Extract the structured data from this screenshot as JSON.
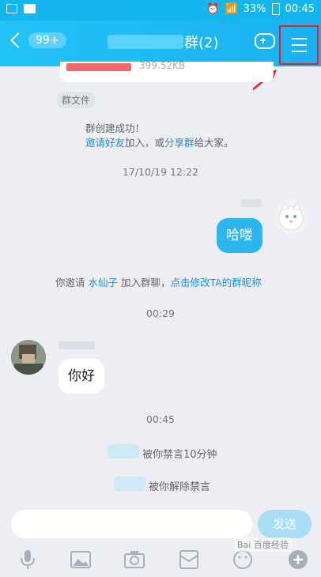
{
  "status_bar": {
    "battery": "33%",
    "time": "00:45"
  },
  "header": {
    "back_badge": "99+",
    "title_suffix": "群(2)"
  },
  "messages": {
    "file_size": "399.52KB",
    "file_tag": "群文件",
    "group_created": "群创建成功！",
    "invite_friends_link": "邀请好友",
    "invite_middle": "加入，或",
    "share_group_link": "分享群",
    "invite_end": "给大家。",
    "time1": "17/10/19 12:22",
    "my_message": "哈喽",
    "invite_notice_prefix": "你邀请",
    "invitee_name": "水仙子",
    "invite_notice_mid": "加入群聊，",
    "modify_nickname_link": "点击修改TA的群昵称",
    "time2": "00:29",
    "their_message": "你好",
    "time3": "00:45",
    "muted_text": "被你禁言10分钟",
    "unmuted_text": "被你解除禁言"
  },
  "input": {
    "placeholder": "",
    "send_label": "发送"
  },
  "watermark": "Bai 百度经验",
  "colors": {
    "accent": "#1ab1f2",
    "link": "#1c8fd9",
    "annotation": "#e8231e"
  }
}
